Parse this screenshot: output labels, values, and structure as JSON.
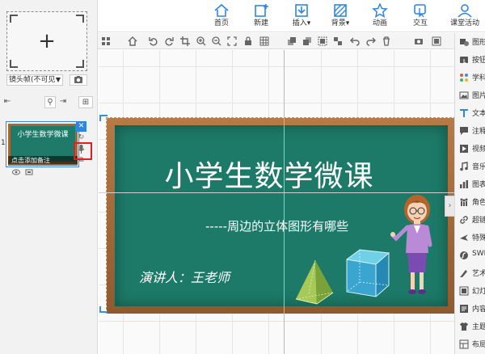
{
  "toolbar": {
    "items": [
      {
        "label": "首页",
        "icon": "home-icon"
      },
      {
        "label": "新建",
        "icon": "new-icon"
      },
      {
        "label": "插入▾",
        "icon": "insert-icon"
      },
      {
        "label": "背景▾",
        "icon": "background-icon"
      },
      {
        "label": "动画",
        "icon": "star-icon"
      },
      {
        "label": "交互",
        "icon": "interact-icon"
      },
      {
        "label": "课堂活动",
        "icon": "user-icon"
      }
    ]
  },
  "left_panel": {
    "frame_select": "镜头帧(不可见",
    "thumbnail": {
      "number": "1",
      "title": "小学生数学微课",
      "caption": "点击添加备注"
    }
  },
  "slide": {
    "title": "小学生数学微课",
    "subtitle": "-----周边的立体图形有哪些",
    "speaker": "演讲人：王老师"
  },
  "right_panel": {
    "items": [
      {
        "label": "图形",
        "icon": "shape-icon"
      },
      {
        "label": "按钮",
        "icon": "button-icon"
      },
      {
        "label": "学科",
        "icon": "subject-icon"
      },
      {
        "label": "图片",
        "icon": "image-icon"
      },
      {
        "label": "文本",
        "icon": "text-icon"
      },
      {
        "label": "注释",
        "icon": "comment-icon"
      },
      {
        "label": "视频",
        "icon": "video-icon"
      },
      {
        "label": "音乐",
        "icon": "music-icon"
      },
      {
        "label": "图表",
        "icon": "chart-icon"
      },
      {
        "label": "角色",
        "icon": "role-icon"
      },
      {
        "label": "超链",
        "icon": "link-icon"
      },
      {
        "label": "特殊",
        "icon": "special-icon"
      },
      {
        "label": "SWF",
        "icon": "swf-icon"
      },
      {
        "label": "艺术",
        "icon": "art-icon"
      },
      {
        "label": "幻灯",
        "icon": "slide-icon"
      },
      {
        "label": "内容",
        "icon": "content-icon"
      },
      {
        "label": "主题",
        "icon": "theme-icon"
      },
      {
        "label": "布局",
        "icon": "layout-icon"
      }
    ]
  },
  "colors": {
    "accent": "#2f86e2",
    "chalkboard": "#1d7a68",
    "frame_wood": "#a36a36",
    "highlight_red": "#e02020"
  }
}
